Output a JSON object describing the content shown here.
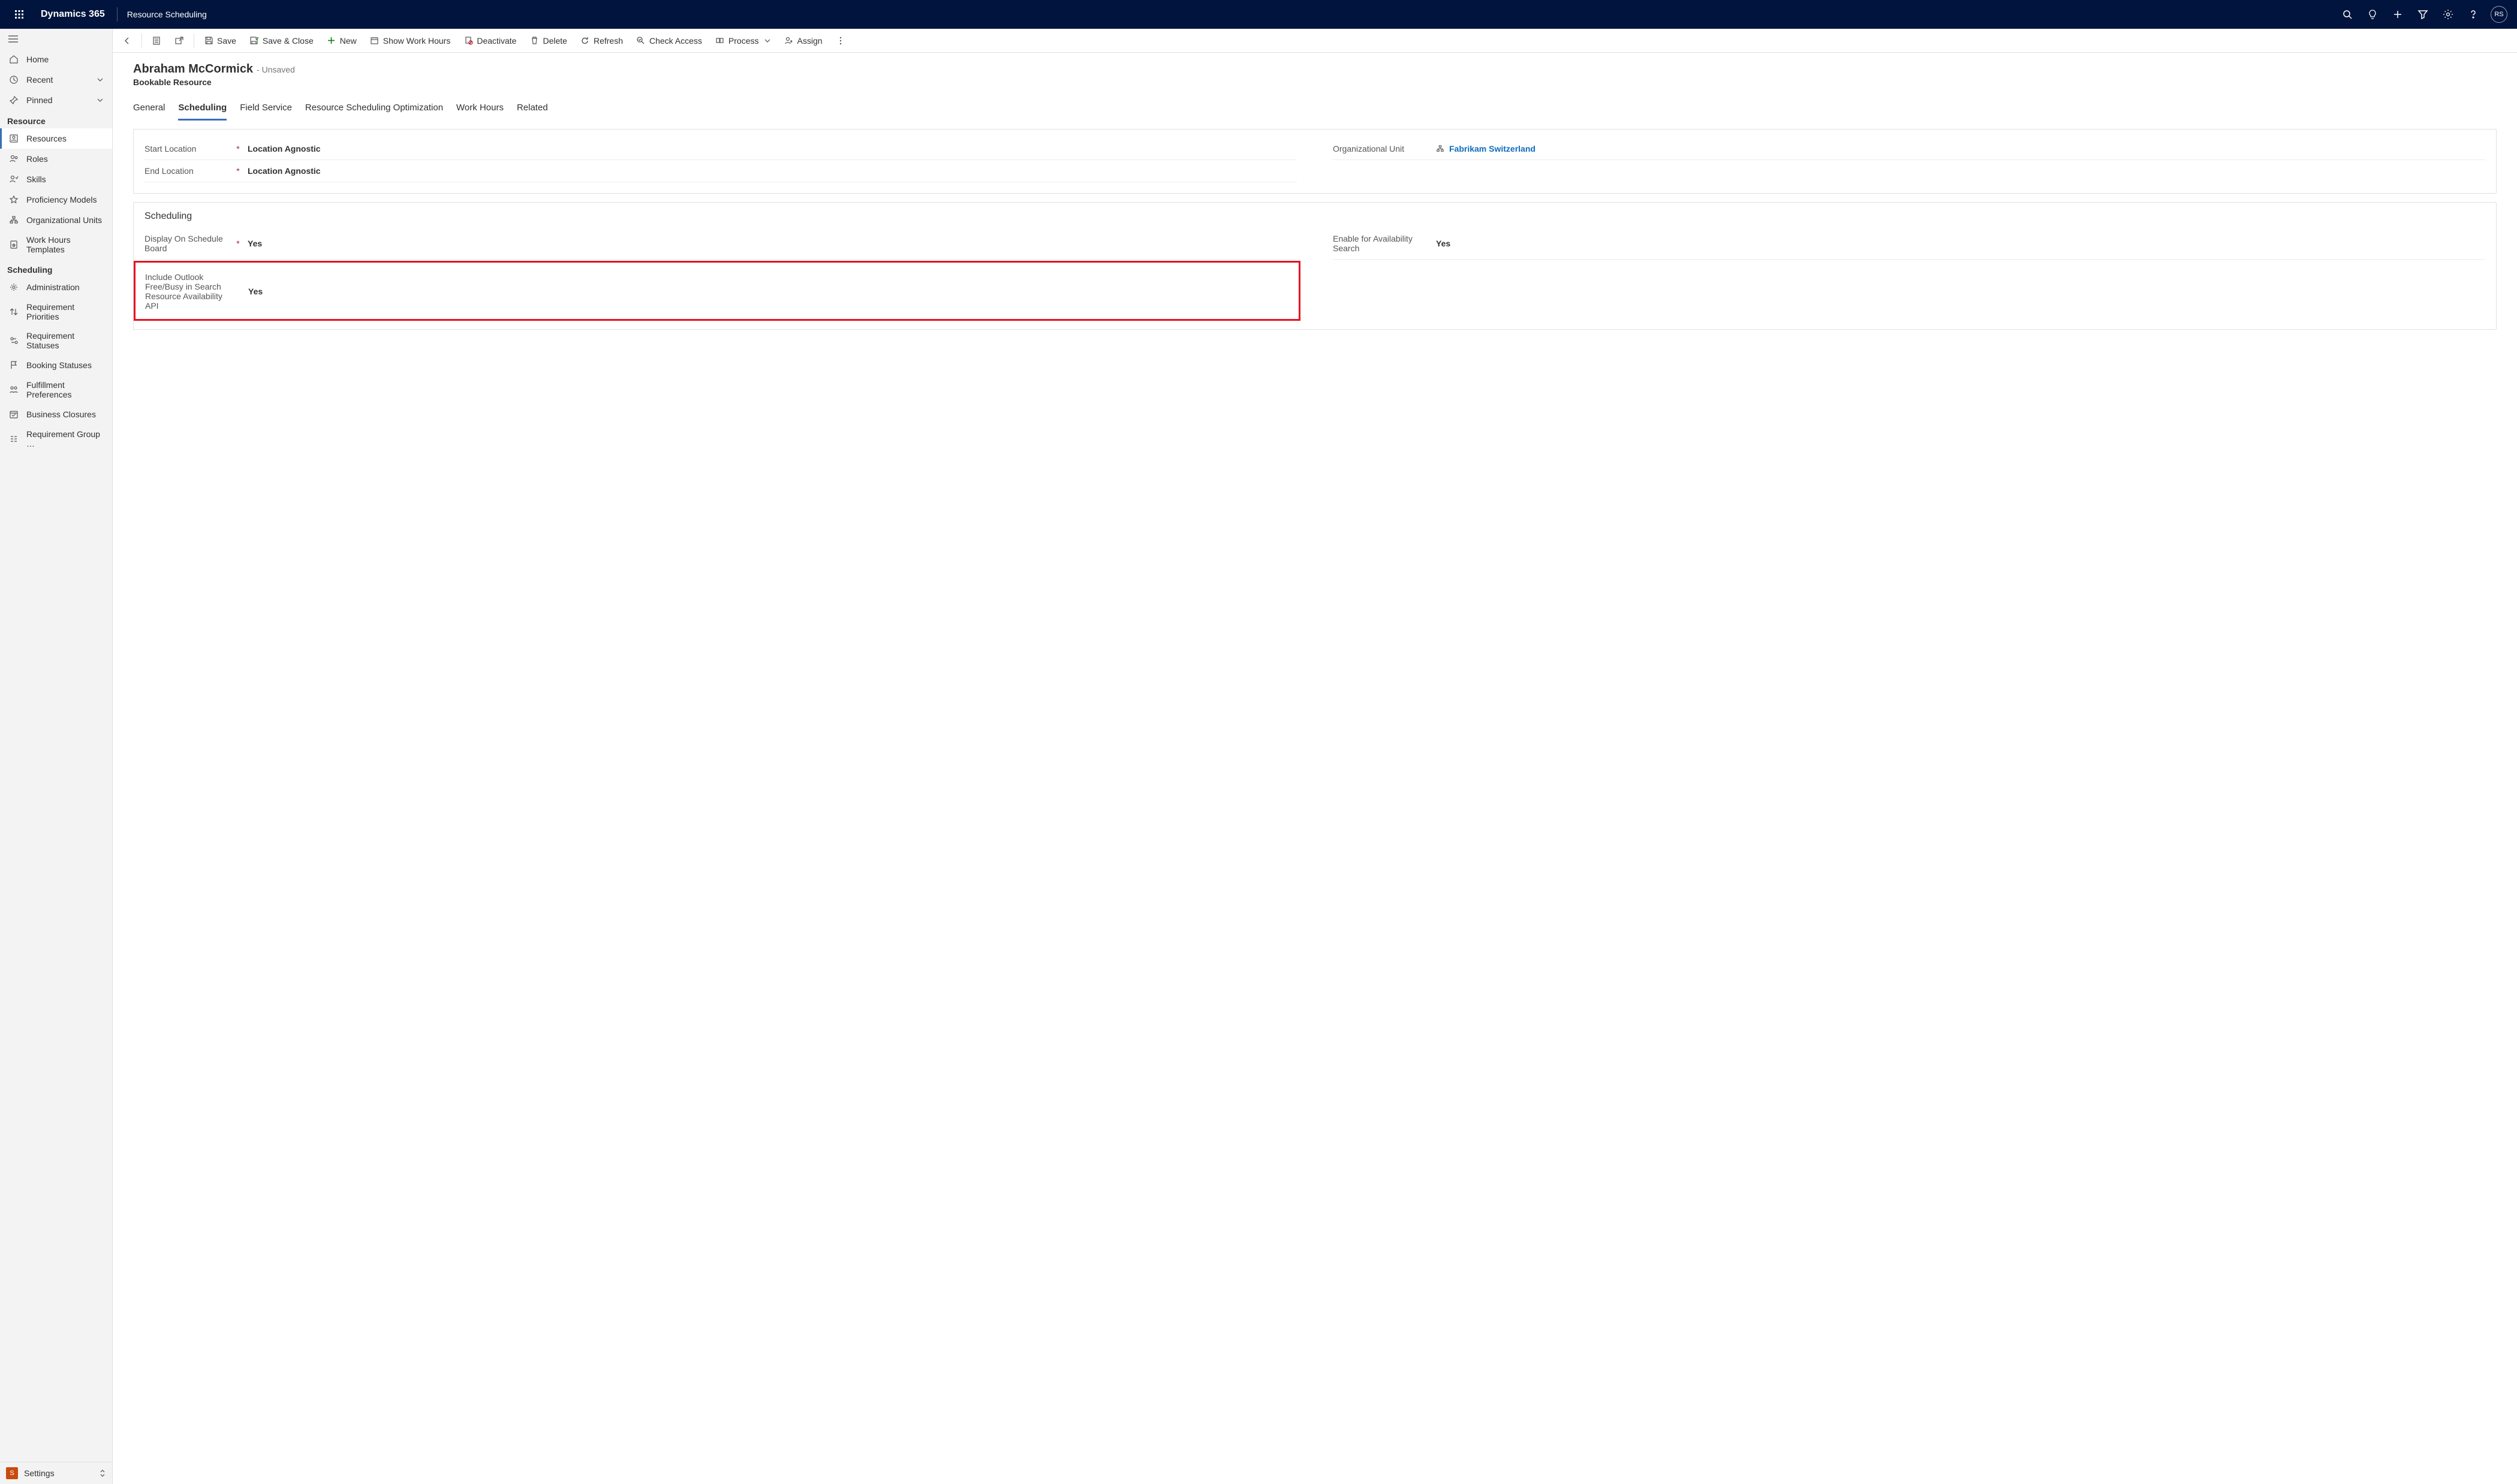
{
  "navbar": {
    "brand": "Dynamics 365",
    "area": "Resource Scheduling",
    "avatar": "RS"
  },
  "sidebar": {
    "top": {
      "home": "Home",
      "recent": "Recent",
      "pinned": "Pinned"
    },
    "resource_header": "Resource",
    "resource_items": {
      "resources": "Resources",
      "roles": "Roles",
      "skills": "Skills",
      "proficiency": "Proficiency Models",
      "org_units": "Organizational Units",
      "work_hours": "Work Hours Templates"
    },
    "scheduling_header": "Scheduling",
    "scheduling_items": {
      "admin": "Administration",
      "req_pri": "Requirement Priorities",
      "req_stat": "Requirement Statuses",
      "book_stat": "Booking Statuses",
      "fulfill": "Fulfillment Preferences",
      "closures": "Business Closures",
      "req_group": "Requirement Group …"
    },
    "footer": {
      "badge": "S",
      "label": "Settings"
    }
  },
  "cmdbar": {
    "save": "Save",
    "save_close": "Save & Close",
    "new": "New",
    "show_wh": "Show Work Hours",
    "deactivate": "Deactivate",
    "delete": "Delete",
    "refresh": "Refresh",
    "check_access": "Check Access",
    "process": "Process",
    "assign": "Assign"
  },
  "page": {
    "title": "Abraham McCormick",
    "unsaved": "- Unsaved",
    "subtitle": "Bookable Resource"
  },
  "tabs": {
    "general": "General",
    "scheduling": "Scheduling",
    "field_service": "Field Service",
    "rso": "Resource Scheduling Optimization",
    "work_hours": "Work Hours",
    "related": "Related"
  },
  "form1": {
    "start_loc_label": "Start Location",
    "start_loc_value": "Location Agnostic",
    "end_loc_label": "End Location",
    "end_loc_value": "Location Agnostic",
    "org_unit_label": "Organizational Unit",
    "org_unit_value": "Fabrikam Switzerland",
    "required": "*"
  },
  "form2": {
    "section_title": "Scheduling",
    "dosb_label": "Display On Schedule Board",
    "dosb_value": "Yes",
    "efas_label": "Enable for Availability Search",
    "efas_value": "Yes",
    "outlook_label": "Include Outlook Free/Busy in Search Resource Availability API",
    "outlook_value": "Yes"
  }
}
